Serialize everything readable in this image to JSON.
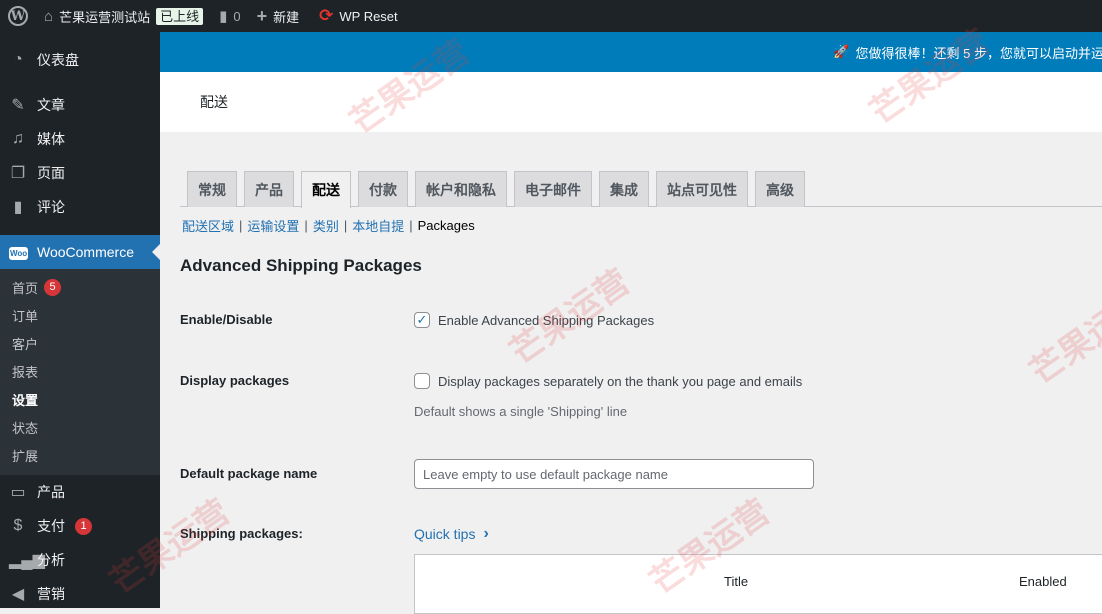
{
  "adminbar": {
    "site_name": "芒果运营测试站",
    "live_badge": "已上线",
    "comments_count": "0",
    "new_label": "新建",
    "wp_reset_label": "WP Reset"
  },
  "notice": {
    "text": "您做得很棒！还剩 5 步，您就可以启动并运"
  },
  "page_header": {
    "title": "配送"
  },
  "sidebar": {
    "items": [
      {
        "label": "仪表盘",
        "icon": "dashboard-icon"
      },
      {
        "label": "文章",
        "icon": "pin-icon"
      },
      {
        "label": "媒体",
        "icon": "media-icon"
      },
      {
        "label": "页面",
        "icon": "pages-icon"
      },
      {
        "label": "评论",
        "icon": "comment-icon"
      },
      {
        "label": "WooCommerce",
        "icon": "woo-icon"
      }
    ],
    "submenu": [
      {
        "label": "首页",
        "badge": "5"
      },
      {
        "label": "订单"
      },
      {
        "label": "客户"
      },
      {
        "label": "报表"
      },
      {
        "label": "设置"
      },
      {
        "label": "状态"
      },
      {
        "label": "扩展"
      }
    ],
    "lower_items": [
      {
        "label": "产品",
        "icon": "archive-icon"
      },
      {
        "label": "支付",
        "icon": "dollar-icon",
        "badge": "1"
      },
      {
        "label": "分析",
        "icon": "bar-chart-icon"
      },
      {
        "label": "营销",
        "icon": "megaphone-icon"
      }
    ]
  },
  "tabs": [
    "常规",
    "产品",
    "配送",
    "付款",
    "帐户和隐私",
    "电子邮件",
    "集成",
    "站点可见性",
    "高级"
  ],
  "active_tab": "配送",
  "subnav": [
    "配送区域",
    "运输设置",
    "类别",
    "本地自提",
    "Packages"
  ],
  "section_title": "Advanced Shipping Packages",
  "settings": {
    "enable": {
      "label": "Enable/Disable",
      "checkbox_label": "Enable Advanced Shipping Packages",
      "checked": true
    },
    "display": {
      "label": "Display packages",
      "checkbox_label": "Display packages separately on the thank you page and emails",
      "checked": false,
      "description": "Default shows a single 'Shipping' line"
    },
    "default_name": {
      "label": "Default package name",
      "value": "",
      "placeholder": "Leave empty to use default package name"
    },
    "shipping_packages": {
      "label": "Shipping packages:",
      "quick_tips": "Quick tips"
    }
  },
  "table": {
    "columns": [
      "Title",
      "Enabled"
    ]
  }
}
